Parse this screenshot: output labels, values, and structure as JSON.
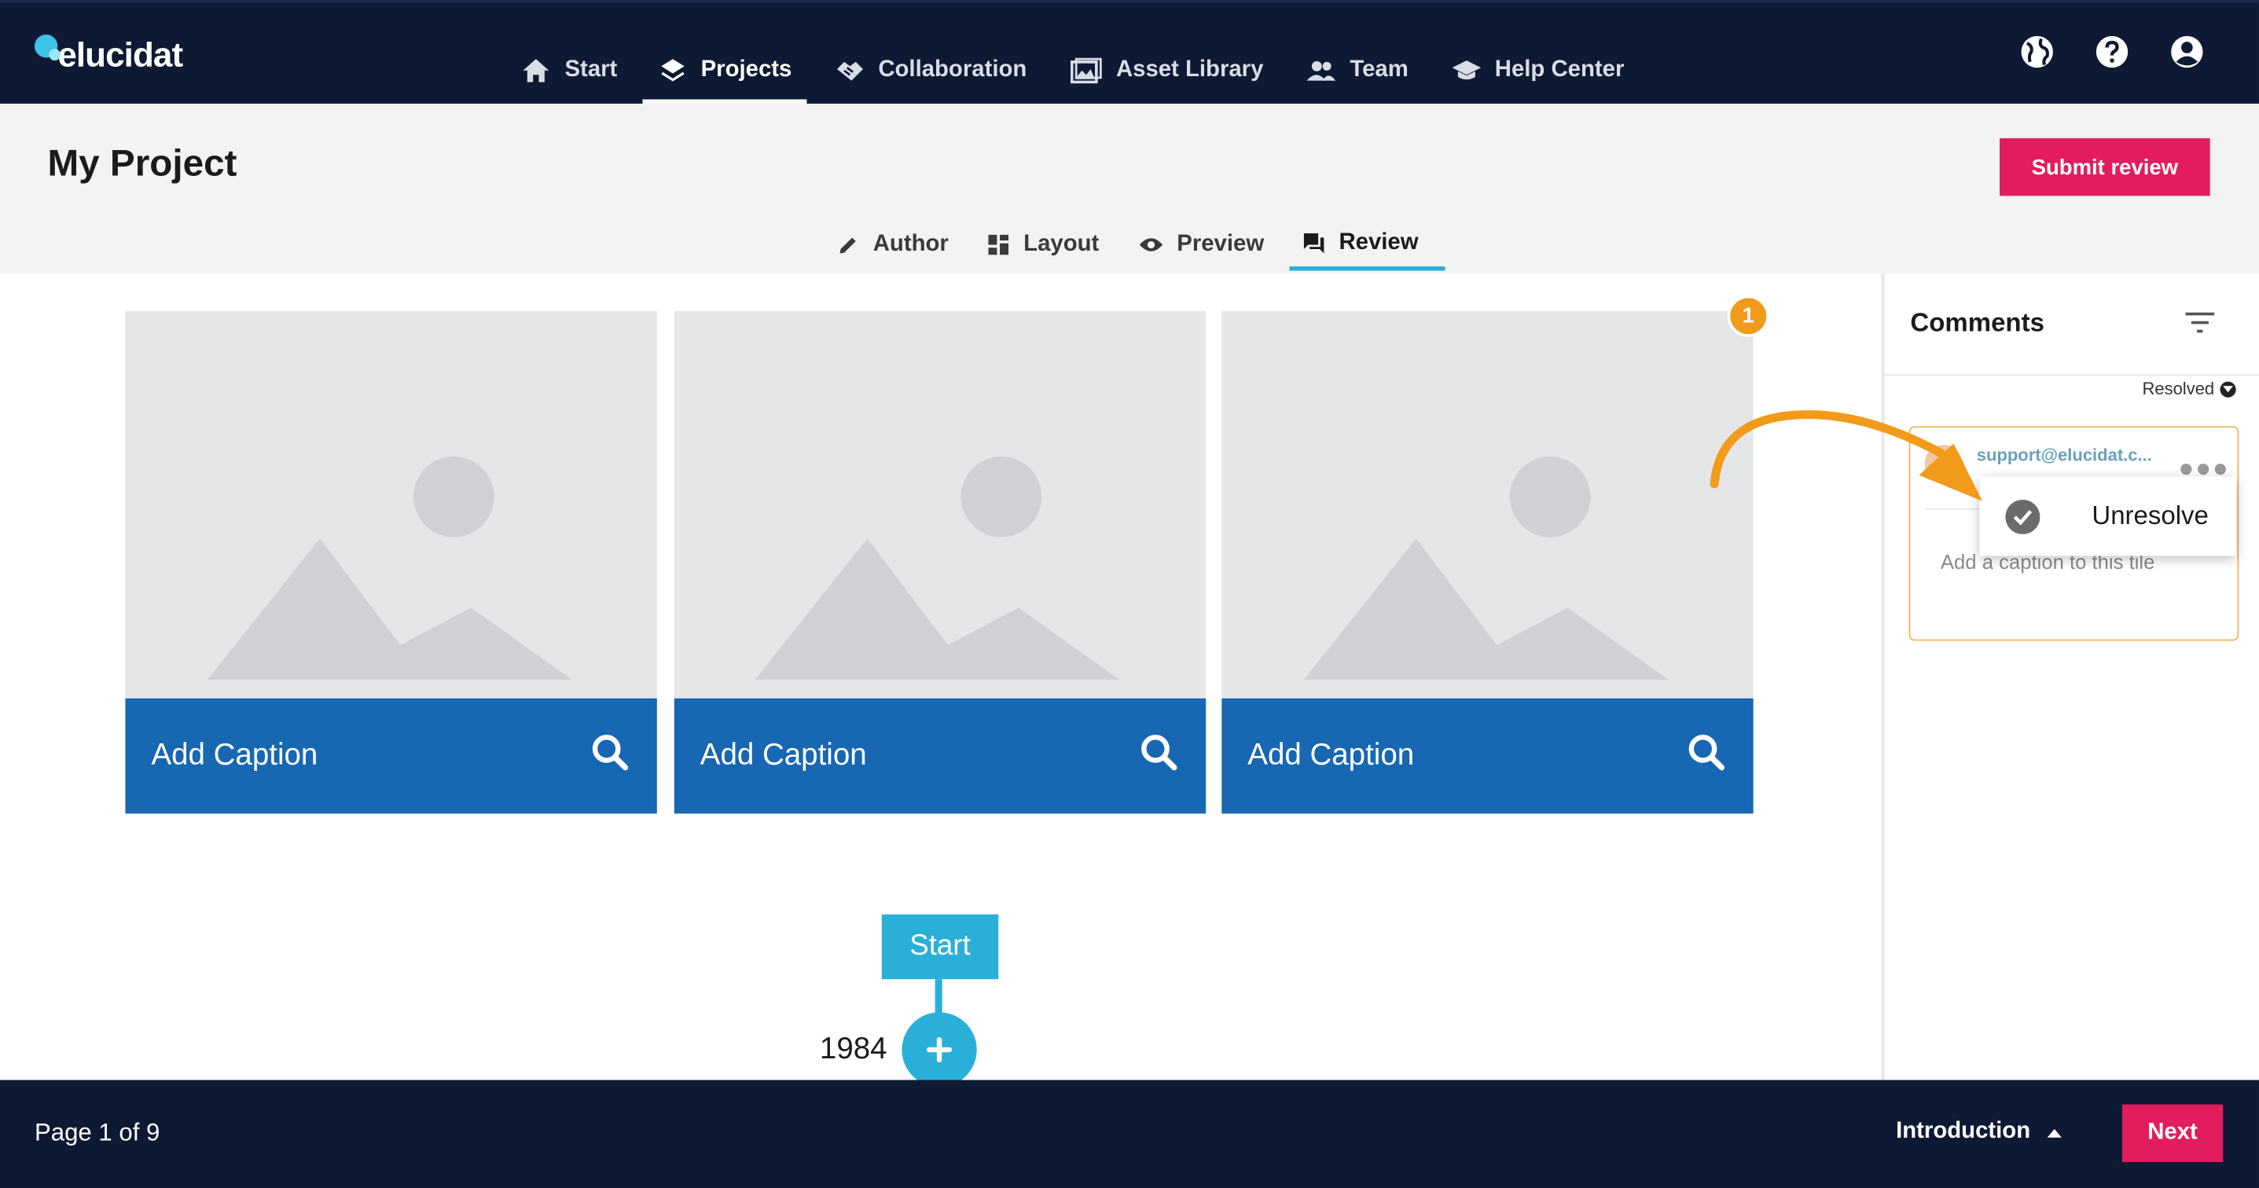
{
  "app": {
    "logo_text": "elucidat"
  },
  "top_nav": {
    "items": [
      {
        "label": "Start",
        "icon": "home-icon"
      },
      {
        "label": "Projects",
        "icon": "layers-icon",
        "active": true
      },
      {
        "label": "Collaboration",
        "icon": "handshake-icon"
      },
      {
        "label": "Asset Library",
        "icon": "images-icon"
      },
      {
        "label": "Team",
        "icon": "team-icon"
      },
      {
        "label": "Help Center",
        "icon": "graduation-cap-icon"
      }
    ],
    "right_icons": [
      "globe-icon",
      "help-icon",
      "account-icon"
    ]
  },
  "project": {
    "title": "My Project",
    "submit_label": "Submit review",
    "tabs": [
      {
        "label": "Author",
        "icon": "pencil-icon"
      },
      {
        "label": "Layout",
        "icon": "grid-icon"
      },
      {
        "label": "Preview",
        "icon": "eye-icon"
      },
      {
        "label": "Review",
        "icon": "comment-icon",
        "active": true
      }
    ]
  },
  "tiles": [
    {
      "caption": "Add Caption"
    },
    {
      "caption": "Add Caption"
    },
    {
      "caption": "Add Caption"
    }
  ],
  "badge_count": "1",
  "timeline": {
    "start_label": "Start",
    "year": "1984"
  },
  "comments": {
    "title": "Comments",
    "filter_label": "Resolved",
    "card": {
      "author": "support@elucidat.c...",
      "text": "Add a caption to this tile"
    },
    "menu": {
      "unresolve_label": "Unresolve"
    }
  },
  "footer": {
    "page_indicator": "Page 1 of 9",
    "chapter": "Introduction",
    "next_label": "Next"
  },
  "colors": {
    "nav_bg": "#0e1a33",
    "accent_pink": "#e21c5d",
    "accent_cyan": "#2ab0d8",
    "caption_blue": "#1767b3",
    "badge_orange": "#f29a1a"
  }
}
